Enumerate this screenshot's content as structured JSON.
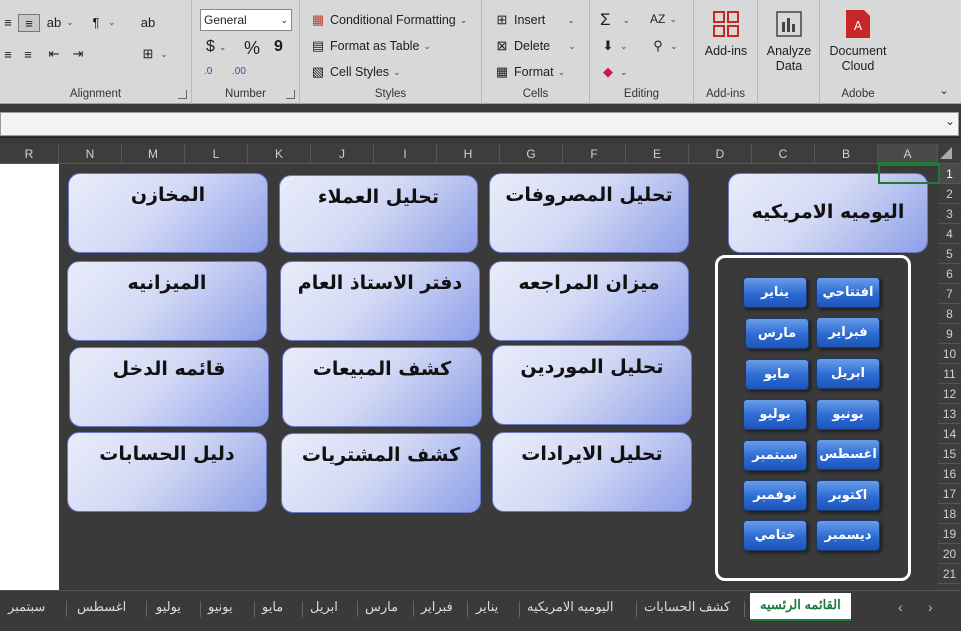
{
  "ribbon": {
    "alignment": {
      "label": "Alignment"
    },
    "number": {
      "format_value": "General",
      "label": "Number",
      "currency": "$",
      "percent": "%",
      "comma": "9",
      "inc_decimal": ".00",
      "dec_decimal": ".0"
    },
    "styles": {
      "label": "Styles",
      "conditional": "Conditional Formatting",
      "format_table": "Format as Table",
      "cell_styles": "Cell Styles"
    },
    "cells": {
      "label": "Cells",
      "insert": "Insert",
      "delete": "Delete",
      "format": "Format"
    },
    "editing": {
      "label": "Editing",
      "sum": "Σ",
      "sort": "AZ"
    },
    "addins": {
      "label": "Add-ins",
      "button": "Add-ins"
    },
    "analyze": {
      "label": "Analyze\nData",
      "line1": "Analyze",
      "line2": "Data"
    },
    "adobe": {
      "label": "Adobe",
      "line1": "Document",
      "line2": "Cloud"
    }
  },
  "columns": [
    "R",
    "N",
    "M",
    "L",
    "K",
    "J",
    "I",
    "H",
    "G",
    "F",
    "E",
    "D",
    "C",
    "B",
    "A"
  ],
  "rows": [
    "1",
    "2",
    "3",
    "4",
    "5",
    "6",
    "7",
    "8",
    "9",
    "10",
    "11",
    "12",
    "13",
    "14",
    "15",
    "16",
    "17",
    "18",
    "19",
    "20",
    "21"
  ],
  "cards": [
    {
      "label": "المخازن"
    },
    {
      "label": "تحليل العملاء"
    },
    {
      "label": "تحليل المصروفات"
    },
    {
      "label": "الميزانيه"
    },
    {
      "label": "دفتر  الاستاذ العام"
    },
    {
      "label": "ميزان المراجعه"
    },
    {
      "label": "قائمه الدخل"
    },
    {
      "label": "كشف المبيعات"
    },
    {
      "label": "تحليل الموردين"
    },
    {
      "label": "دليل الحسابات"
    },
    {
      "label": "كشف المشتريات"
    },
    {
      "label": "تحليل الايرادات"
    }
  ],
  "daily_card": {
    "label": "اليوميه الامريكيه"
  },
  "months": [
    {
      "label": "افتتاحي"
    },
    {
      "label": "يناير"
    },
    {
      "label": "فبراير"
    },
    {
      "label": "مارس"
    },
    {
      "label": "ابريل"
    },
    {
      "label": "مايو"
    },
    {
      "label": "يونيو"
    },
    {
      "label": "يوليو"
    },
    {
      "label": "اغسطس"
    },
    {
      "label": "سبتمبر"
    },
    {
      "label": "اكتوبر"
    },
    {
      "label": "نوفمبر"
    },
    {
      "label": "ديسمبر"
    },
    {
      "label": "ختامي"
    }
  ],
  "sheet_tabs": {
    "active": "القائمه الرئسيه",
    "others": [
      "كشف الحسابات",
      "اليوميه الامريكيه",
      "يناير",
      "فبراير",
      "مارس",
      "ابريل",
      "مايو",
      "يونيو",
      "يوليو",
      "اغسطس",
      "سبتمبر"
    ]
  },
  "colors": {
    "accent": "#1f7a3a",
    "card_start": "#e8ecfa",
    "card_end": "#8d9fe8",
    "month_button": "#2c6bd4"
  }
}
